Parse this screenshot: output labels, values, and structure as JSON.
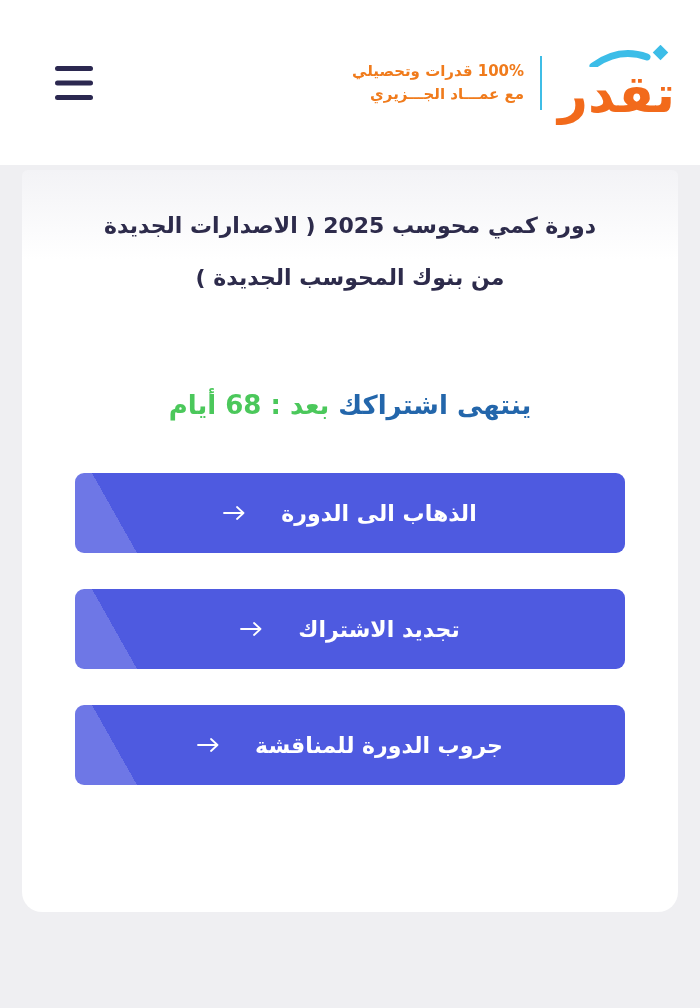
{
  "header": {
    "logo": {
      "wordmark": "تقدر",
      "tagline_lines": [
        "100% قدرات وتحصيلي",
        "مع عمـــاد الجـــزيري"
      ]
    }
  },
  "course": {
    "title": "دورة كمي محوسب 2025 ( الاصدارات الجديدة من بنوك المحوسب الجديدة )",
    "expiry": {
      "label": "ينتهى اشتراكك",
      "countdown": "بعد : 68 أيام"
    },
    "actions": [
      {
        "label": "الذهاب الى الدورة"
      },
      {
        "label": "تجديد الاشتراك"
      },
      {
        "label": "جروب الدورة للمناقشة"
      }
    ]
  }
}
